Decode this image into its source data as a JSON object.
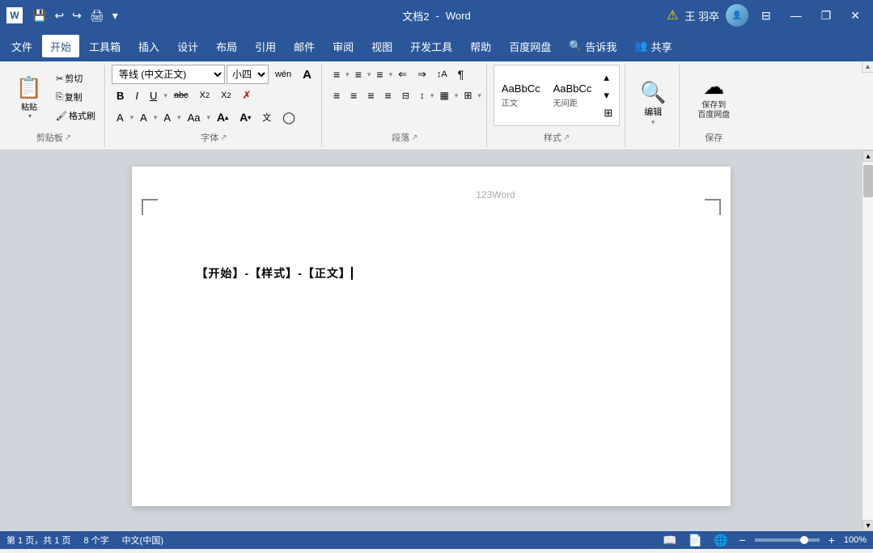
{
  "titlebar": {
    "title": "文档2 - Word",
    "doc_name": "文档2",
    "app_name": "Word",
    "warning": "⚠",
    "user": "王 羽卒",
    "minimize": "—",
    "restore": "❐",
    "close": "✕"
  },
  "menubar": {
    "items": [
      {
        "id": "file",
        "label": "文件"
      },
      {
        "id": "home",
        "label": "开始",
        "active": true
      },
      {
        "id": "toolbox",
        "label": "工具箱"
      },
      {
        "id": "insert",
        "label": "插入"
      },
      {
        "id": "design",
        "label": "设计"
      },
      {
        "id": "layout",
        "label": "布局"
      },
      {
        "id": "references",
        "label": "引用"
      },
      {
        "id": "mail",
        "label": "邮件"
      },
      {
        "id": "review",
        "label": "审阅"
      },
      {
        "id": "view",
        "label": "视图"
      },
      {
        "id": "devtools",
        "label": "开发工具"
      },
      {
        "id": "help",
        "label": "帮助"
      },
      {
        "id": "baidu",
        "label": "百度网盘"
      },
      {
        "id": "tellme",
        "label": "告诉我"
      },
      {
        "id": "share",
        "label": "共享"
      }
    ]
  },
  "ribbon": {
    "groups": {
      "clipboard": {
        "label": "剪贴板",
        "paste_label": "粘贴",
        "cut_label": "剪切",
        "copy_label": "复制",
        "format_label": "格式刷"
      },
      "font": {
        "label": "字体",
        "font_name": "等线 (中文正文)",
        "font_size": "小四",
        "expand_btn": "文A",
        "bold": "B",
        "italic": "I",
        "underline": "U",
        "strikethrough": "abc",
        "subscript": "X₂",
        "superscript": "X²",
        "clear": "清",
        "font_color_a": "A",
        "highlight": "A",
        "text_color": "A",
        "increase": "A↑",
        "decrease": "A↓",
        "change_case": "Aa",
        "phonetic": "文",
        "circle": "○"
      },
      "paragraph": {
        "label": "段落",
        "bullets": "≡",
        "numbering": "≡",
        "multilevel": "≡",
        "decrease_indent": "⇐",
        "increase_indent": "⇒",
        "sort": "排",
        "show_marks": "¶",
        "align_left": "≡",
        "center": "≡",
        "align_right": "≡",
        "justify": "≡",
        "columns": "⊟",
        "line_spacing": "↕",
        "shading": "▣",
        "border": "⊞",
        "expand": "▾"
      },
      "styles": {
        "label": "样式",
        "normal_label": "正文",
        "no_spacing_label": "无间距",
        "style_btn": "样式",
        "expand": "▾"
      },
      "editing": {
        "label": "编辑",
        "btn_label": "编辑"
      },
      "save": {
        "label": "保存",
        "save_to_baidu": "保存到\n百度网盘"
      }
    }
  },
  "document": {
    "header_text": "123Word",
    "content_line": "【开始】-【样式】-【正文】",
    "cursor_visible": true
  },
  "statusbar": {
    "page_info": "第 1 页，共 1 页",
    "word_count": "8 个字",
    "lang": "中文(中国)",
    "zoom": "100%",
    "zoom_value": 100
  }
}
